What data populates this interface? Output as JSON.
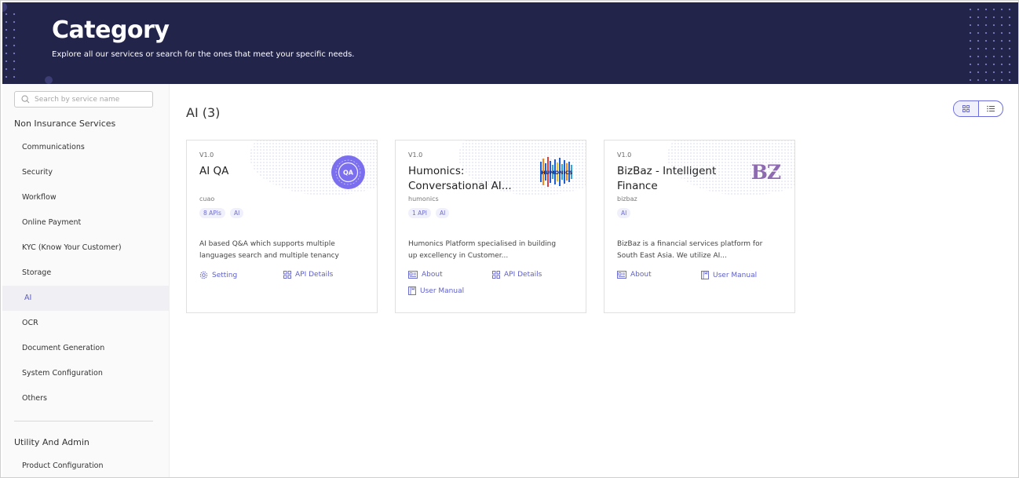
{
  "header": {
    "title": "Category",
    "subtitle": "Explore all our services or search for the ones that meet your specific needs."
  },
  "sidebar": {
    "search_placeholder": "Search by service name",
    "groups": [
      {
        "title": "Non Insurance Services",
        "items": [
          {
            "label": "Communications"
          },
          {
            "label": "Security"
          },
          {
            "label": "Workflow"
          },
          {
            "label": "Online Payment"
          },
          {
            "label": "KYC (Know Your Customer)"
          },
          {
            "label": "Storage"
          },
          {
            "label": "AI",
            "active": true
          },
          {
            "label": "OCR"
          },
          {
            "label": "Document Generation"
          },
          {
            "label": "System Configuration"
          },
          {
            "label": "Others"
          }
        ]
      },
      {
        "title": "Utility And Admin",
        "items": [
          {
            "label": "Product Configuration"
          }
        ]
      }
    ]
  },
  "main": {
    "section_title": "AI (3)",
    "view_toggle": {
      "options": [
        "grid-icon",
        "list-icon"
      ],
      "selected": "grid-icon"
    },
    "cards": [
      {
        "version": "V1.0",
        "title": "AI QA",
        "provider": "cuao",
        "tags": [
          "8 APIs",
          "AI"
        ],
        "logo": {
          "text": "QA",
          "color": "#7b6ff0"
        },
        "description": "AI based Q&A which supports multiple languages search and multiple tenancy",
        "actions": [
          {
            "label": "Setting",
            "icon": "gear-icon"
          },
          {
            "label": "API Details",
            "icon": "grid-icon"
          }
        ]
      },
      {
        "version": "V1.0",
        "title": "Humonics: Conversational AI...",
        "provider": "humonics",
        "tags": [
          "1 API",
          "AI"
        ],
        "logo": {
          "text": "HUMONICS",
          "color": "#2a64d6"
        },
        "description": "Humonics Platform specialised in building up excellency in Customer...",
        "actions": [
          {
            "label": "About",
            "icon": "id-card-icon"
          },
          {
            "label": "API Details",
            "icon": "grid-icon"
          },
          {
            "label": "User Manual",
            "icon": "book-icon"
          }
        ]
      },
      {
        "version": "V1.0",
        "title": "BizBaz - Intelligent Finance",
        "provider": "bizbaz",
        "tags": [
          "AI"
        ],
        "logo": {
          "text": "BZ",
          "color": "#8e6bb0"
        },
        "description": "BizBaz is a financial services platform for South East Asia. We utilize AI...",
        "actions": [
          {
            "label": "About",
            "icon": "id-card-icon"
          },
          {
            "label": "User Manual",
            "icon": "book-icon"
          }
        ]
      }
    ]
  },
  "colors": {
    "header_bg": "#23244a",
    "accent": "#5d5fcb",
    "tag_bg": "#eff0fb"
  }
}
